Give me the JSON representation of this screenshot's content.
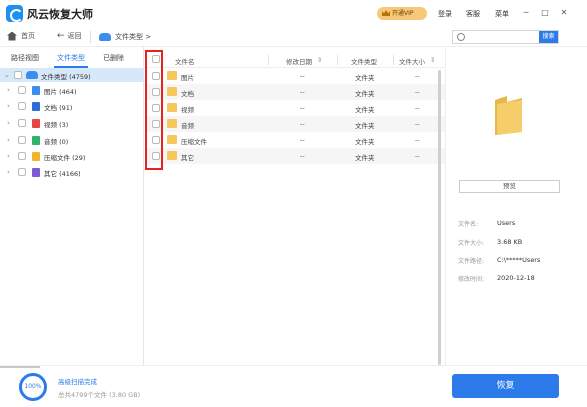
{
  "app": {
    "title": "风云恢复大师"
  },
  "titlebar": {
    "vip_label": "开通VIP",
    "login": "登录",
    "service": "客服",
    "menu": "菜单",
    "minimize_icon": "minimize-icon",
    "maximize_icon": "maximize-icon",
    "close_icon": "close-icon"
  },
  "nav": {
    "home": "首页",
    "back": "返回",
    "breadcrumb": "文件类型 >",
    "search_placeholder": "",
    "search_button": "搜索"
  },
  "tabs": [
    {
      "label": "路径视图",
      "active": false
    },
    {
      "label": "文件类型",
      "active": true
    },
    {
      "label": "已删除",
      "active": false
    }
  ],
  "tree": [
    {
      "label": "文件类型 (4759)",
      "icon": "drive-icon",
      "color": "#3a8ef0",
      "selected": true
    },
    {
      "label": "图片 (464)",
      "icon": "image-file-icon",
      "color": "#3a8ef0"
    },
    {
      "label": "文档 (91)",
      "icon": "document-file-icon",
      "color": "#2d6fd6"
    },
    {
      "label": "视频 (3)",
      "icon": "video-file-icon",
      "color": "#e64545"
    },
    {
      "label": "音频 (0)",
      "icon": "audio-file-icon",
      "color": "#2db36a"
    },
    {
      "label": "压缩文件 (29)",
      "icon": "archive-file-icon",
      "color": "#f0b429"
    },
    {
      "label": "其它 (4166)",
      "icon": "other-file-icon",
      "color": "#7b5cd6"
    }
  ],
  "table": {
    "headers": {
      "name": "文件名",
      "modified": "修改日期",
      "type": "文件类型",
      "size": "文件大小"
    },
    "rows": [
      {
        "name": "图片",
        "modified": "--",
        "type": "文件夹",
        "size": "--"
      },
      {
        "name": "文档",
        "modified": "--",
        "type": "文件夹",
        "size": "--"
      },
      {
        "name": "视频",
        "modified": "--",
        "type": "文件夹",
        "size": "--"
      },
      {
        "name": "音频",
        "modified": "--",
        "type": "文件夹",
        "size": "--"
      },
      {
        "name": "压缩文件",
        "modified": "--",
        "type": "文件夹",
        "size": "--"
      },
      {
        "name": "其它",
        "modified": "--",
        "type": "文件夹",
        "size": "--"
      }
    ]
  },
  "preview": {
    "button": "预览",
    "info": [
      {
        "label": "文件名:",
        "value": "Users"
      },
      {
        "label": "文件大小:",
        "value": "3.68 KB"
      },
      {
        "label": "文件路径:",
        "value": "C:\\*****Users"
      },
      {
        "label": "修改时间:",
        "value": "2020-12-18"
      }
    ]
  },
  "status": {
    "progress": "100%",
    "title": "高级扫描完成",
    "subtitle": "总共4799个文件 (3.80 GB)",
    "recover_button": "恢复"
  },
  "colors": {
    "accent": "#2d7bea",
    "folder": "#f5c85c",
    "highlight": "#e42222"
  }
}
